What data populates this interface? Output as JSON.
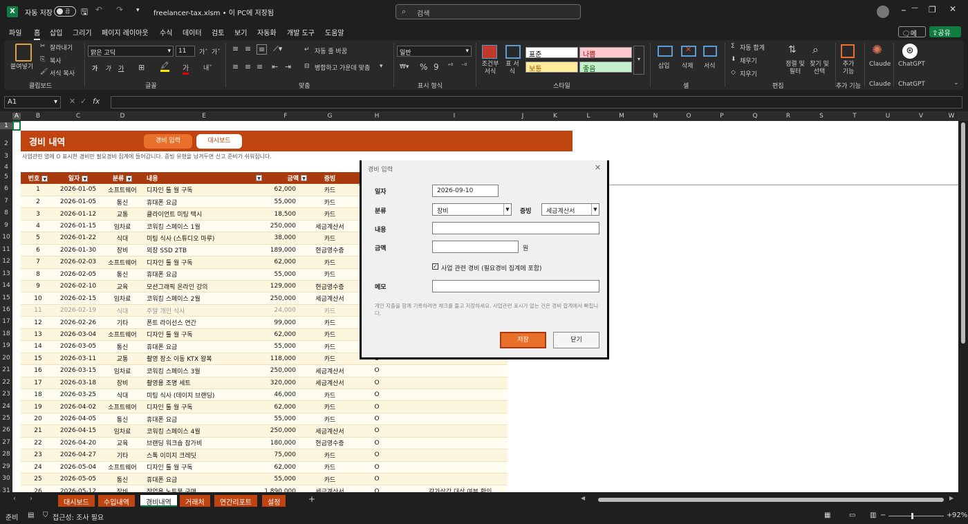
{
  "titlebar": {
    "autosave_label": "자동 저장",
    "autosave_state": "끔",
    "filename": "freelancer-tax.xlsm • 이 PC에 저장됨",
    "search_placeholder": "검색"
  },
  "menu": [
    "파일",
    "홈",
    "삽입",
    "그리기",
    "페이지 레이아웃",
    "수식",
    "데이터",
    "검토",
    "보기",
    "자동화",
    "개발 도구",
    "도움말"
  ],
  "menu_active": "홈",
  "menu_right": {
    "memo": "메모",
    "share": "공유"
  },
  "ribbon": {
    "paste": "붙여넣기",
    "cut": "잘라내기",
    "copy": "복사",
    "format_painter": "서식 복사",
    "clipboard_group": "클립보드",
    "font_name": "맑은 고딕",
    "font_size": "11",
    "font_group": "글꼴",
    "wrap_text": "자동 줄 바꿈",
    "merge_center": "병합하고 가운데 맞춤",
    "align_group": "맞춤",
    "number_format": "일반",
    "number_group": "표시 형식",
    "cond_format": "조건부 서식",
    "table_format": "표 서식",
    "style_normal": "표준",
    "style_bad": "나쁨",
    "style_neutral": "보통",
    "style_good": "좋음",
    "style_group": "스타일",
    "insert": "삽입",
    "delete": "삭제",
    "format": "서식",
    "cells_group": "셀",
    "autosum": "자동 합계",
    "fill": "채우기",
    "clear": "지우기",
    "sort_filter": "정렬 및 필터",
    "find_select": "찾기 및 선택",
    "edit_group": "편집",
    "addins": "추가 기능",
    "addins_group": "추가 기능",
    "claude": "Claude",
    "claude_group": "Claude",
    "chatgpt": "ChatGPT",
    "chatgpt_group": "ChatGPT"
  },
  "formula": {
    "namebox": "A1",
    "fx": "fx",
    "value": ""
  },
  "columns": [
    "A",
    "B",
    "C",
    "D",
    "E",
    "F",
    "G",
    "H",
    "I",
    "J",
    "K",
    "L",
    "M",
    "N",
    "O",
    "P",
    "Q",
    "R",
    "S",
    "T",
    "U",
    "V",
    "W"
  ],
  "rows": [
    "1",
    "2",
    "3",
    "4",
    "5",
    "6",
    "7",
    "8",
    "9",
    "10",
    "11",
    "12",
    "13",
    "14",
    "15",
    "16",
    "17",
    "18",
    "19",
    "20",
    "21",
    "22",
    "23",
    "24",
    "25",
    "26",
    "27",
    "28",
    "29",
    "30",
    "31"
  ],
  "sheet": {
    "title": "경비 내역",
    "btn_entry": "경비 입력",
    "btn_dashboard": "대시보드",
    "subtitle": "사업관련 열에 O 표시한 경비만 필요경비 집계에 들어갑니다. 증빙 유형을 남겨두면 신고 준비가 쉬워집니다.",
    "headers": [
      "번호",
      "일자",
      "분류",
      "내용",
      "금액",
      "증빙",
      "",
      ""
    ],
    "rows": [
      [
        "1",
        "2026-01-05",
        "소프트웨어",
        "디자인 툴 월 구독",
        "62,000",
        "카드",
        "",
        ""
      ],
      [
        "2",
        "2026-01-05",
        "통신",
        "휴대폰 요금",
        "55,000",
        "카드",
        "",
        ""
      ],
      [
        "3",
        "2026-01-12",
        "교통",
        "클라이언트 미팅 택시",
        "18,500",
        "카드",
        "",
        ""
      ],
      [
        "4",
        "2026-01-15",
        "임차료",
        "코워킹 스페이스 1월",
        "250,000",
        "세금계산서",
        "",
        ""
      ],
      [
        "5",
        "2026-01-22",
        "식대",
        "미팅 식사 (스튜디오 마루)",
        "38,000",
        "카드",
        "",
        ""
      ],
      [
        "6",
        "2026-01-30",
        "장비",
        "외장 SSD 2TB",
        "189,000",
        "현금영수증",
        "",
        ""
      ],
      [
        "7",
        "2026-02-03",
        "소프트웨어",
        "디자인 툴 월 구독",
        "62,000",
        "카드",
        "",
        ""
      ],
      [
        "8",
        "2026-02-05",
        "통신",
        "휴대폰 요금",
        "55,000",
        "카드",
        "",
        ""
      ],
      [
        "9",
        "2026-02-10",
        "교육",
        "모션그래픽 온라인 강의",
        "129,000",
        "현금영수증",
        "",
        ""
      ],
      [
        "10",
        "2026-02-15",
        "임차료",
        "코워킹 스페이스 2월",
        "250,000",
        "세금계산서",
        "",
        ""
      ],
      [
        "11",
        "2026-02-19",
        "식대",
        "주말 개인 식사",
        "24,000",
        "카드",
        "",
        ""
      ],
      [
        "12",
        "2026-02-26",
        "기타",
        "폰트 라이선스 연간",
        "99,000",
        "카드",
        "",
        ""
      ],
      [
        "13",
        "2026-03-04",
        "소프트웨어",
        "디자인 툴 월 구독",
        "62,000",
        "카드",
        "",
        ""
      ],
      [
        "14",
        "2026-03-05",
        "통신",
        "휴대폰 요금",
        "55,000",
        "카드",
        "",
        ""
      ],
      [
        "15",
        "2026-03-11",
        "교통",
        "촬영 장소 이동 KTX 왕복",
        "118,000",
        "카드",
        "O",
        ""
      ],
      [
        "16",
        "2026-03-15",
        "임차료",
        "코워킹 스페이스 3월",
        "250,000",
        "세금계산서",
        "O",
        ""
      ],
      [
        "17",
        "2026-03-18",
        "장비",
        "촬영용 조명 세트",
        "320,000",
        "세금계산서",
        "O",
        ""
      ],
      [
        "18",
        "2026-03-25",
        "식대",
        "미팅 식사 (데이지 브랜딩)",
        "46,000",
        "카드",
        "O",
        ""
      ],
      [
        "19",
        "2026-04-02",
        "소프트웨어",
        "디자인 툴 월 구독",
        "62,000",
        "카드",
        "O",
        ""
      ],
      [
        "20",
        "2026-04-05",
        "통신",
        "휴대폰 요금",
        "55,000",
        "카드",
        "O",
        ""
      ],
      [
        "21",
        "2026-04-15",
        "임차료",
        "코워킹 스페이스 4월",
        "250,000",
        "세금계산서",
        "O",
        ""
      ],
      [
        "22",
        "2026-04-20",
        "교육",
        "브랜딩 워크숍 참가비",
        "180,000",
        "현금영수증",
        "O",
        ""
      ],
      [
        "23",
        "2026-04-27",
        "기타",
        "스톡 이미지 크레딧",
        "75,000",
        "카드",
        "O",
        ""
      ],
      [
        "24",
        "2026-05-04",
        "소프트웨어",
        "디자인 툴 월 구독",
        "62,000",
        "카드",
        "O",
        ""
      ],
      [
        "25",
        "2026-05-05",
        "통신",
        "휴대폰 요금",
        "55,000",
        "카드",
        "O",
        ""
      ],
      [
        "26",
        "2026-05-12",
        "장비",
        "작업용 노트북 구매",
        "1,890,000",
        "세금계산서",
        "O",
        "감가상각 대상 여부 확인"
      ]
    ]
  },
  "dialog": {
    "title": "경비 입력",
    "date_label": "일자",
    "date_value": "2026-09-10",
    "category_label": "분류",
    "category_value": "장비",
    "proof_label": "증빙",
    "proof_value": "세금계산서",
    "content_label": "내용",
    "content_value": "",
    "amount_label": "금액",
    "amount_value": "",
    "amount_unit": "원",
    "business_check_label": "사업 관련 경비 (필요경비 집계에 포함)",
    "memo_label": "메모",
    "memo_value": "",
    "hint": "개인 지출을 함께 기록하려면 체크를 풀고 저장하세요. 사업관련 표시가 없는 건은 경비 합계에서 빠집니다.",
    "save": "저장",
    "close": "닫기"
  },
  "tabs": [
    "대시보드",
    "수입내역",
    "경비내역",
    "거래처",
    "연간리포트",
    "설정"
  ],
  "tab_active": "경비내역",
  "status": {
    "ready": "준비",
    "accessibility": "접근성: 조사 필요",
    "zoom": "92%"
  }
}
